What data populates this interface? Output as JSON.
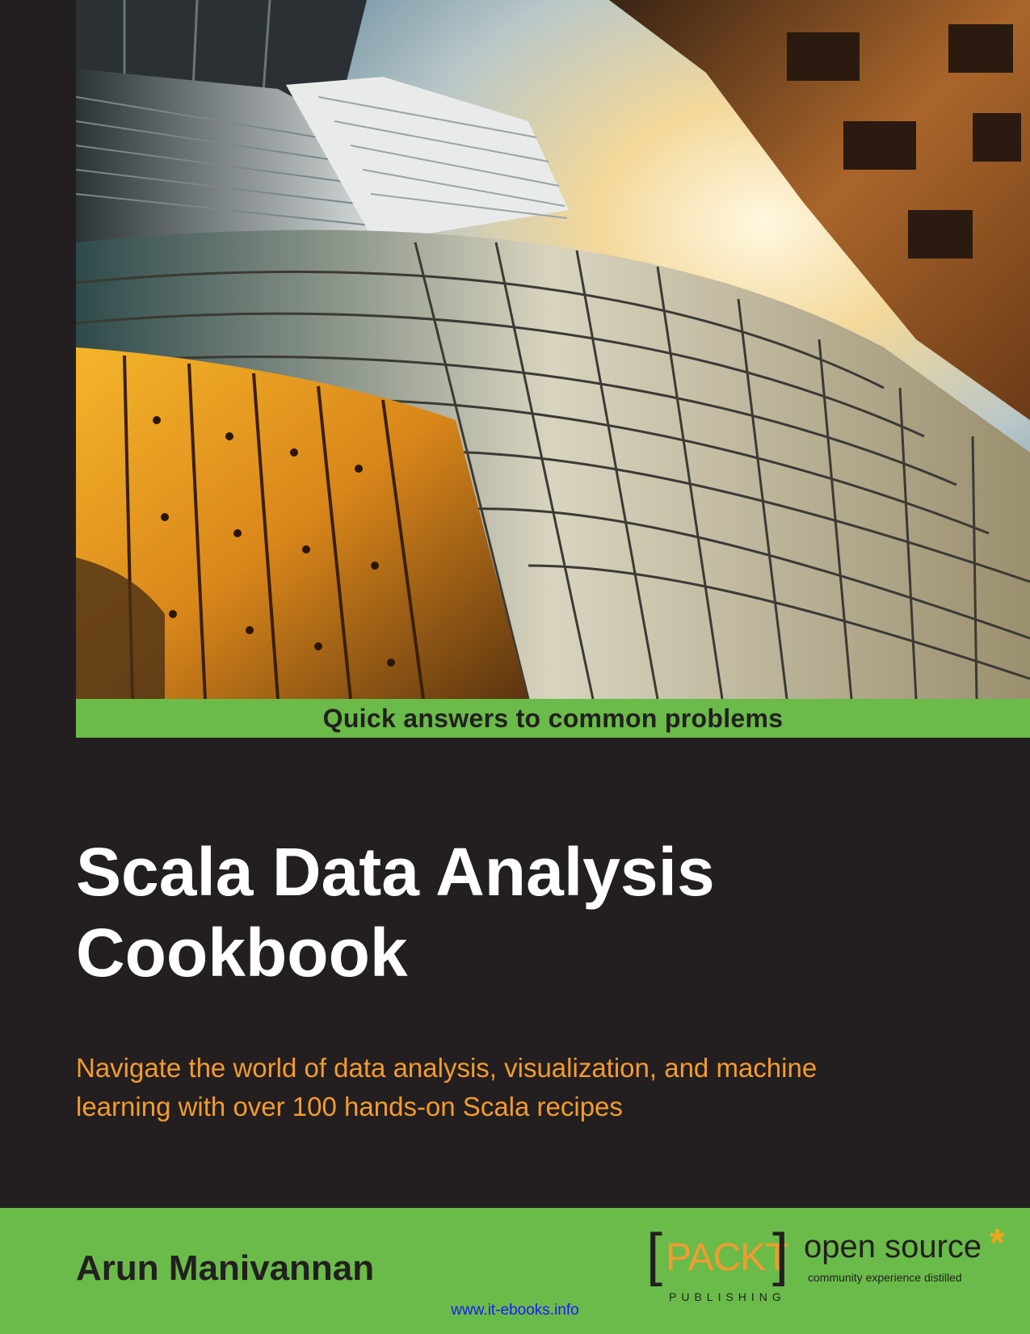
{
  "cover": {
    "series_banner": "Quick answers to common problems",
    "title_line1": "Scala Data Analysis",
    "title_line2": "Cookbook",
    "subtitle_line1": "Navigate the world of data analysis, visualization, and machine",
    "subtitle_line2": "learning with over 100 hands-on Scala recipes",
    "author": "Arun Manivannan",
    "photo": "skyscrapers-looking-up-photo"
  },
  "publisher": {
    "bracket_left": "[",
    "bracket_right": "]",
    "name": "PACKT",
    "publishing": "PUBLISHING",
    "open_source": "open source",
    "star": "*",
    "tagline": "community experience distilled"
  },
  "footer": {
    "link": "www.it-ebooks.info"
  },
  "colors": {
    "dark": "#231f20",
    "green": "#6abb4a",
    "orange": "#f39b2f",
    "link": "#1a1aff"
  }
}
